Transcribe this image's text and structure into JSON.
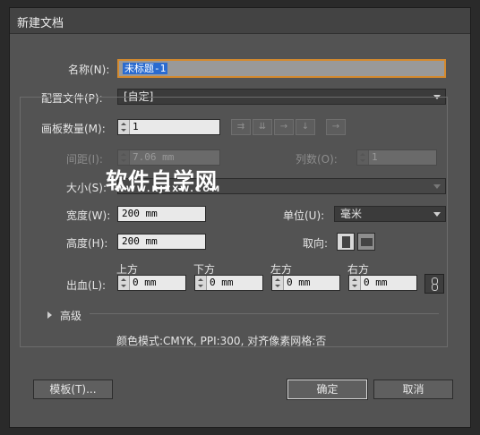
{
  "window": {
    "title": "新建文档"
  },
  "name": {
    "label": "名称(N):",
    "value": "未标题-1"
  },
  "profile": {
    "label": "配置文件(P):",
    "value": "[自定]"
  },
  "artboards": {
    "label": "画板数量(M):",
    "value": "1"
  },
  "spacing": {
    "label": "间距(I):",
    "value": "7.06 mm"
  },
  "columns": {
    "label": "列数(O):",
    "value": "1"
  },
  "size": {
    "label": "大小(S):"
  },
  "width": {
    "label": "宽度(W):",
    "value": "200 mm"
  },
  "units": {
    "label": "单位(U):",
    "value": "毫米"
  },
  "height": {
    "label": "高度(H):",
    "value": "200 mm"
  },
  "orientation": {
    "label": "取向:"
  },
  "bleed": {
    "label": "出血(L):",
    "top_label": "上方",
    "bottom_label": "下方",
    "left_label": "左方",
    "right_label": "右方",
    "top": "0 mm",
    "bottom": "0 mm",
    "left": "0 mm",
    "right": "0 mm"
  },
  "advanced": {
    "label": "高级"
  },
  "info": "颜色模式:CMYK, PPI:300, 对齐像素网格:否",
  "buttons": {
    "templates": "模板(T)...",
    "ok": "确定",
    "cancel": "取消"
  },
  "watermark": {
    "main": "软件自学网",
    "url": "WWW.RJZXW.COM"
  }
}
